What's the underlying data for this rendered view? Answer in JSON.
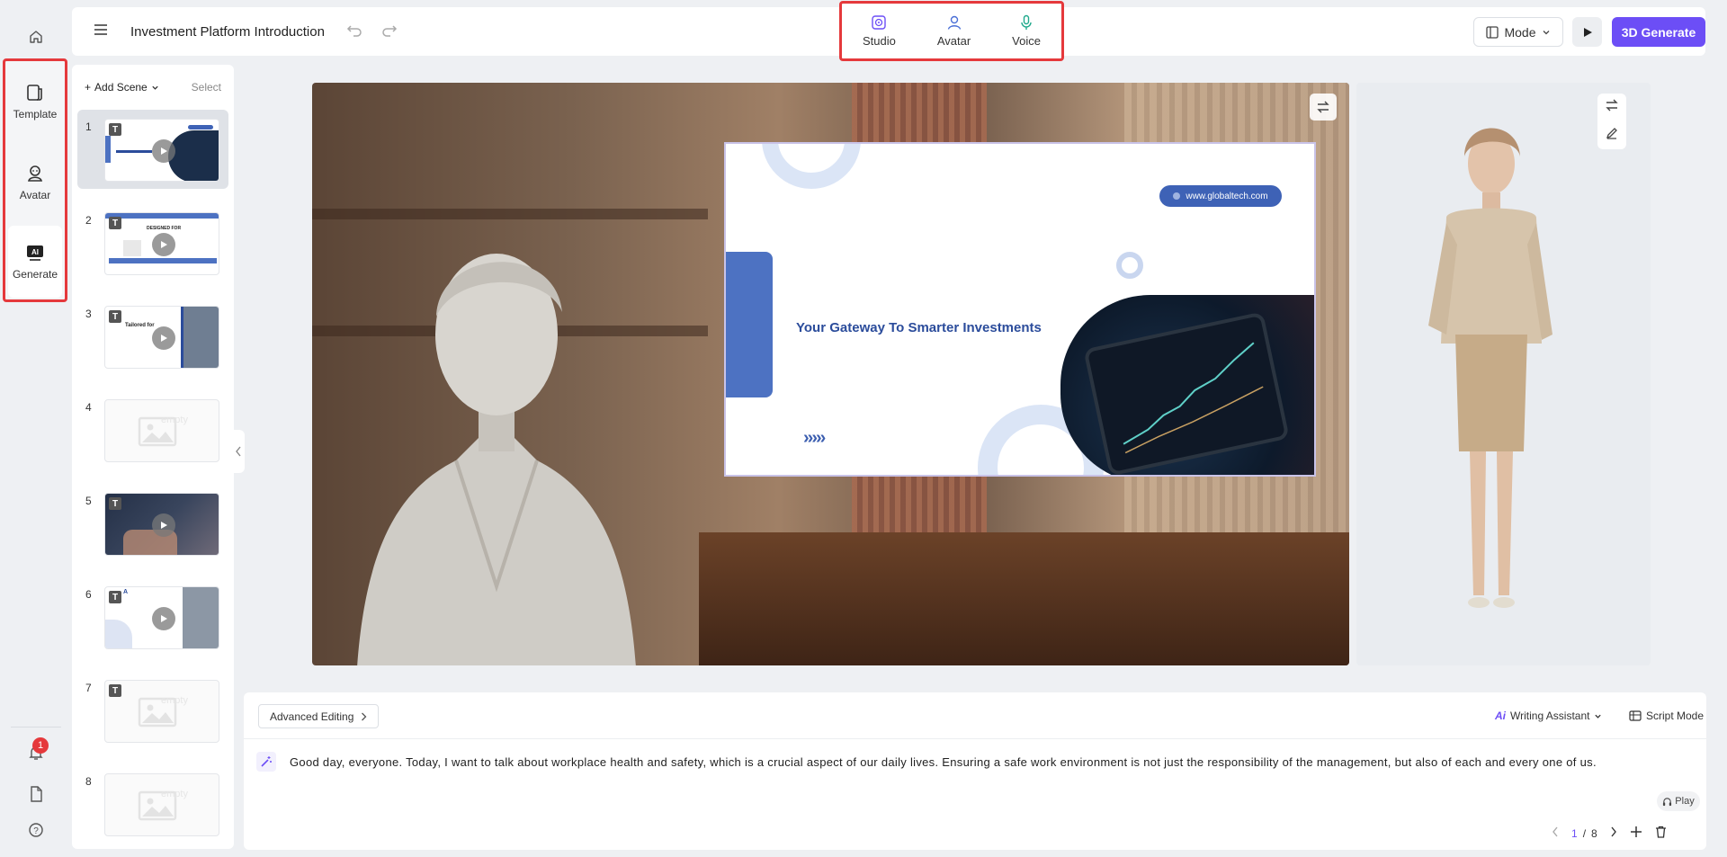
{
  "app": {
    "title": "Investment Platform Introduction"
  },
  "rail": {
    "items": [
      {
        "label": "Template",
        "icon": "template-icon"
      },
      {
        "label": "Avatar",
        "icon": "avatar-icon"
      },
      {
        "label": "Generate",
        "icon": "ai-generate-icon"
      }
    ],
    "notification_count": "1"
  },
  "topbar": {
    "tabs": [
      {
        "label": "Studio",
        "icon": "studio-icon"
      },
      {
        "label": "Avatar",
        "icon": "person-icon"
      },
      {
        "label": "Voice",
        "icon": "microphone-icon"
      }
    ],
    "mode_label": "Mode",
    "generate_label": "3D Generate",
    "accent": "#6c4ef6",
    "highlight": "#e5393c"
  },
  "scenes": {
    "add_label": "Add Scene",
    "select_label": "Select",
    "items": [
      {
        "number": "1",
        "badge": "T",
        "kind": "slide"
      },
      {
        "number": "2",
        "badge": "T",
        "kind": "slide",
        "caption": "DESIGNED FOR"
      },
      {
        "number": "3",
        "badge": "T",
        "kind": "slide",
        "caption": "Tailored for"
      },
      {
        "number": "4",
        "badge": "",
        "kind": "empty",
        "caption": "empty"
      },
      {
        "number": "5",
        "badge": "T",
        "kind": "video"
      },
      {
        "number": "6",
        "badge": "T",
        "kind": "slide",
        "caption": "A"
      },
      {
        "number": "7",
        "badge": "T",
        "kind": "empty",
        "caption": "empty"
      },
      {
        "number": "8",
        "badge": "",
        "kind": "empty",
        "caption": "empty"
      }
    ]
  },
  "canvas": {
    "slide_url": "www.globaltech.com",
    "slide_title": "Your Gateway To Smarter Investments",
    "slide_arrows": "›››››"
  },
  "script": {
    "advanced_editing": "Advanced Editing",
    "writing_assistant": "Writing Assistant",
    "script_mode": "Script Mode",
    "text": "Good day, everyone. Today, I want to talk about workplace health and safety, which is a crucial aspect of our daily lives. Ensuring a safe work environment is not just the responsibility of the management, but also of each and every one of us.",
    "play_label": "Play",
    "page_current": "1",
    "page_separator": "/",
    "page_total": "8"
  }
}
